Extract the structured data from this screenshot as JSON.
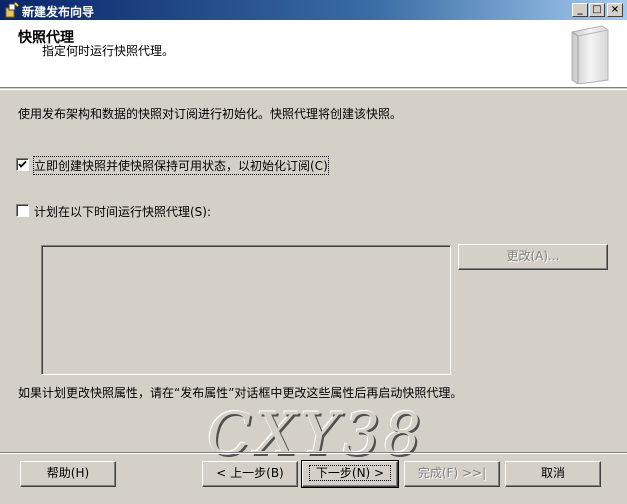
{
  "window": {
    "title": "新建发布向导",
    "controls": {
      "minimize": "_",
      "maximize": "□",
      "close": "×"
    }
  },
  "header": {
    "title": "快照代理",
    "subtitle": "指定何时运行快照代理。",
    "icon": "book-icon"
  },
  "intro_text": "使用发布架构和数据的快照对订阅进行初始化。快照代理将创建该快照。",
  "options": {
    "create_now": {
      "label": "立即创建快照并使快照保持可用状态，以初始化订阅(C)",
      "checked": true
    },
    "schedule": {
      "label": "计划在以下时间运行快照代理(S):",
      "checked": false
    }
  },
  "change_button": "更改(A)...",
  "footnote": "如果计划更改快照属性，请在“发布属性”对话框中更改这些属性后再启动快照代理。",
  "watermark": "CXY38",
  "buttons": {
    "help": "帮助(H)",
    "back": "< 上一步(B)",
    "next": "下一步(N) >",
    "finish": "完成(F) >>|",
    "cancel": "取消"
  },
  "colors": {
    "dialog_bg": "#d4d0c8",
    "title_start": "#0a246a",
    "title_end": "#a6caf0",
    "disabled_text": "#808080"
  }
}
